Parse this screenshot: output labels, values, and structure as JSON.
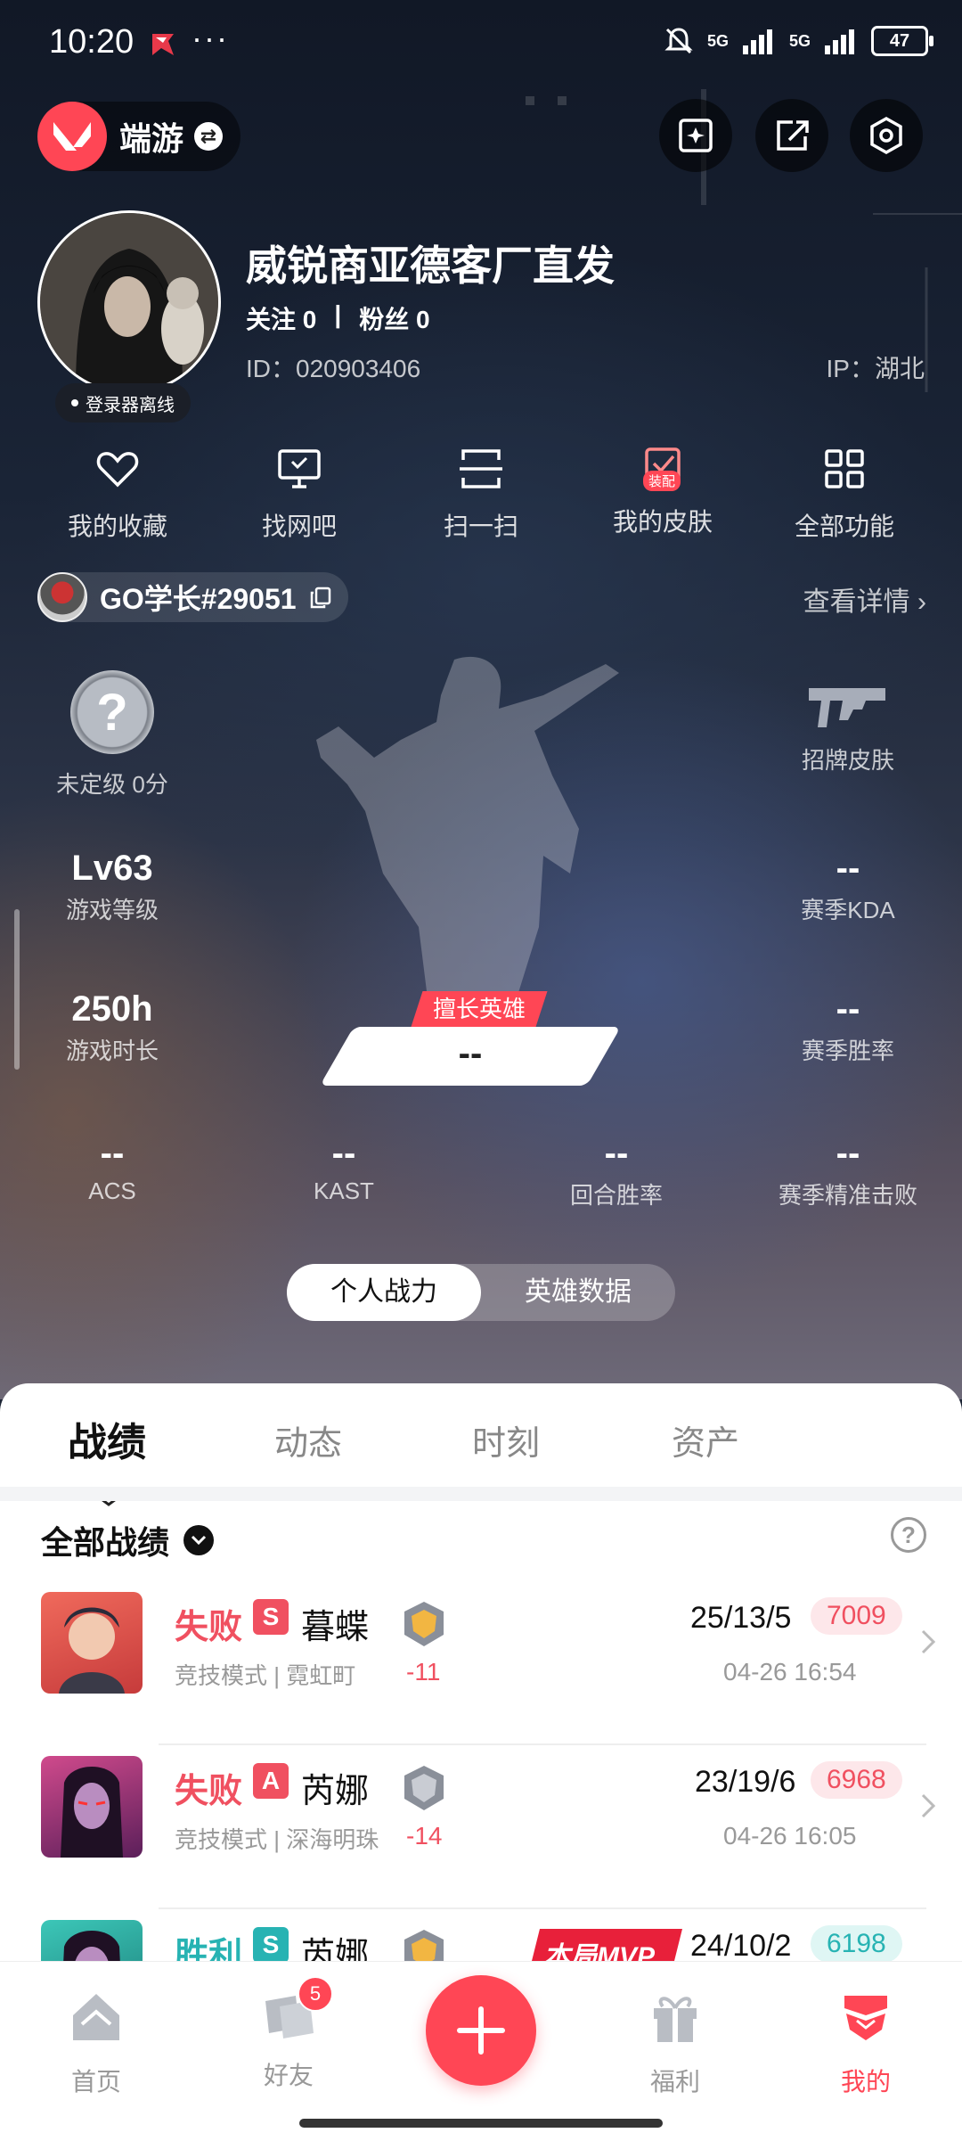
{
  "status": {
    "time": "10:20",
    "dots": "···",
    "signal1": "5G",
    "signal2": "5G",
    "battery": "47"
  },
  "top": {
    "game": "端游"
  },
  "profile": {
    "nickname": "威锐商亚德客厂直发",
    "follow": "关注 0",
    "divider": "|",
    "fans": "粉丝 0",
    "id": "ID：020903406",
    "ip": "IP：湖北",
    "offline": "登录器离线"
  },
  "quick": [
    {
      "label": "我的收藏",
      "icon": "heart-icon"
    },
    {
      "label": "找网吧",
      "icon": "monitor-icon"
    },
    {
      "label": "扫一扫",
      "icon": "scan-icon"
    },
    {
      "label": "我的皮肤",
      "icon": "skin-icon",
      "badge": "装配"
    },
    {
      "label": "全部功能",
      "icon": "grid-icon"
    }
  ],
  "account": {
    "name": "GO学长#29051",
    "detail": "查看详情"
  },
  "stats": {
    "rank": {
      "value": "未定级 0分",
      "icon": "?"
    },
    "signature_skin": "招牌皮肤",
    "level": {
      "value": "Lv63",
      "label": "游戏等级"
    },
    "kda": {
      "value": "--",
      "label": "赛季KDA"
    },
    "hours": {
      "value": "250h",
      "label": "游戏时长"
    },
    "winrate": {
      "value": "--",
      "label": "赛季胜率"
    },
    "fav_hero": {
      "tag": "擅长英雄",
      "value": "--"
    },
    "acs": {
      "value": "--",
      "label": "ACS"
    },
    "kast": {
      "value": "--",
      "label": "KAST"
    },
    "round_win": {
      "value": "--",
      "label": "回合胜率"
    },
    "precise": {
      "value": "--",
      "label": "赛季精准击败"
    }
  },
  "toggle": {
    "left": "个人战力",
    "right": "英雄数据"
  },
  "tabs": [
    "战绩",
    "动态",
    "时刻",
    "资产"
  ],
  "filter": {
    "label": "全部战绩"
  },
  "matches": [
    {
      "result": "失败",
      "grade": "S",
      "agent": "暮蝶",
      "mode": "竞技模式 | 霓虹町",
      "delta": "-11",
      "kda": "25/13/5",
      "score": "7009",
      "date": "04-26 16:54",
      "outcome": "lose",
      "grade_color": "#f05060",
      "avatar_color": "#e8554e"
    },
    {
      "result": "失败",
      "grade": "A",
      "agent": "芮娜",
      "mode": "竞技模式 | 深海明珠",
      "delta": "-14",
      "kda": "23/19/6",
      "score": "6968",
      "date": "04-26 16:05",
      "outcome": "lose",
      "grade_color": "#f05060",
      "avatar_color": "#b0387a"
    },
    {
      "result": "胜利",
      "grade": "S",
      "agent": "芮娜",
      "mode": "",
      "delta": "",
      "kda": "24/10/2",
      "score": "6198",
      "date": "",
      "outcome": "win",
      "grade_color": "#27b3b3",
      "avatar_color": "#2bb3a8",
      "mvp": "本局MVP"
    }
  ],
  "nav": [
    {
      "label": "首页",
      "icon": "home-icon"
    },
    {
      "label": "好友",
      "icon": "friends-icon",
      "badge": "5"
    },
    {
      "label": "福利",
      "icon": "gift-icon"
    },
    {
      "label": "我的",
      "icon": "profile-icon"
    }
  ]
}
